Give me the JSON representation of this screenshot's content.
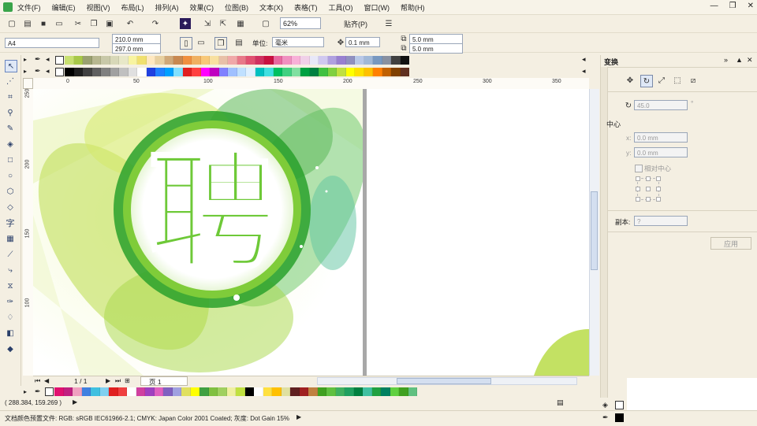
{
  "menu": [
    "文件(F)",
    "编辑(E)",
    "视图(V)",
    "布局(L)",
    "排列(A)",
    "效果(C)",
    "位图(B)",
    "文本(X)",
    "表格(T)",
    "工具(O)",
    "窗口(W)",
    "帮助(H)"
  ],
  "window_controls": {
    "minimize": "—",
    "restore": "❐",
    "close": "✕"
  },
  "standard_toolbar": {
    "zoom_value": "62%",
    "snap_label": "贴齐(P)"
  },
  "property_bar": {
    "page_size": "A4",
    "width": "210.0 mm",
    "height": "297.0 mm",
    "units_label": "单位:",
    "units_value": "毫米",
    "nudge": "0.1 mm",
    "dup_x": "5.0 mm",
    "dup_y": "5.0 mm"
  },
  "ruler": {
    "h_ticks": [
      "0",
      "50",
      "100",
      "150",
      "200",
      "250",
      "300",
      "350"
    ],
    "v_ticks": [
      "250",
      "200",
      "150",
      "100"
    ]
  },
  "artwork": {
    "character": "聘"
  },
  "page_nav": {
    "position": "1 / 1",
    "tab": "页 1"
  },
  "docker": {
    "title": "变换",
    "angle": "45.0",
    "angle_unit": "°",
    "center_label": "中心",
    "x_label": "x:",
    "x_value": "0.0 mm",
    "y_label": "y:",
    "y_value": "0.0 mm",
    "relative_center": "相对中心",
    "copies_label": "副本:",
    "copies_value": "?",
    "apply_button": "应用"
  },
  "status": {
    "coords": "( 288.384, 159.269 )",
    "profile": "文档颜色预置文件: RGB: sRGB IEC61966-2.1; CMYK: Japan Color 2001 Coated; 灰度: Dot Gain 15%"
  },
  "colors": {
    "accent_green": "#7dc832",
    "dark_green": "#1f9a23",
    "char_green": "#6ec938",
    "ui_bg": "#f4efe2"
  },
  "palette_top1": [
    "#c8e070",
    "#a8c848",
    "#9aa070",
    "#b8b890",
    "#c8c8a8",
    "#d8d8b8",
    "#e8e8c8",
    "#f8f4a0",
    "#f0e070",
    "#ffe8c0",
    "#e8d0a0",
    "#d0a878",
    "#c88850",
    "#f09040",
    "#f0b060",
    "#f8c878",
    "#f8e0a0",
    "#e8c0a8",
    "#f0a8a8",
    "#e87888",
    "#e05070",
    "#d03060",
    "#c81040",
    "#e868a0",
    "#f090c0",
    "#f8b0d8",
    "#f0d0e8",
    "#e8e8f8",
    "#d0c8f0",
    "#b0a0e0",
    "#9880d0",
    "#9090c0",
    "#b8c8e8",
    "#a0b8d8",
    "#7898c0",
    "#8890a0",
    "#404040",
    "#101010"
  ],
  "palette_top2": [
    "#000000",
    "#202020",
    "#404040",
    "#606060",
    "#808080",
    "#a0a0a0",
    "#c0c0c0",
    "#e0e0e0",
    "#ffffff",
    "#2040e0",
    "#2080ff",
    "#00a0ff",
    "#80e0ff",
    "#e02020",
    "#ff4040",
    "#ff00ff",
    "#c000c0",
    "#8080ff",
    "#a0c0ff",
    "#c0e0ff",
    "#e0f0ff",
    "#00c0c0",
    "#40e0e0",
    "#00c060",
    "#40d080",
    "#80e0a0",
    "#00a040",
    "#008040",
    "#40c040",
    "#80d040",
    "#c0e040",
    "#ffff00",
    "#ffe000",
    "#ffc000",
    "#ff8000",
    "#c06000",
    "#804000",
    "#603020"
  ],
  "palette_bottom": [
    "#e01070",
    "#c02080",
    "#f0a0c0",
    "#4080e0",
    "#40c0e0",
    "#80d0f0",
    "#e02020",
    "#f04040",
    "#ffffff",
    "#d040a0",
    "#a040c0",
    "#e060c0",
    "#8060c0",
    "#a0a0e0",
    "#e0e060",
    "#ffff00",
    "#40a040",
    "#80c040",
    "#a0d060",
    "#f0f0a0",
    "#c0e040",
    "#000000",
    "#ffffff",
    "#ffe040",
    "#ffc000",
    "#e0e0a0",
    "#602020",
    "#a02020",
    "#c08040",
    "#40a020",
    "#60c040",
    "#40b060",
    "#20a060",
    "#008040",
    "#40c0a0",
    "#20a040",
    "#008060",
    "#60d040",
    "#40a020",
    "#60c080"
  ]
}
